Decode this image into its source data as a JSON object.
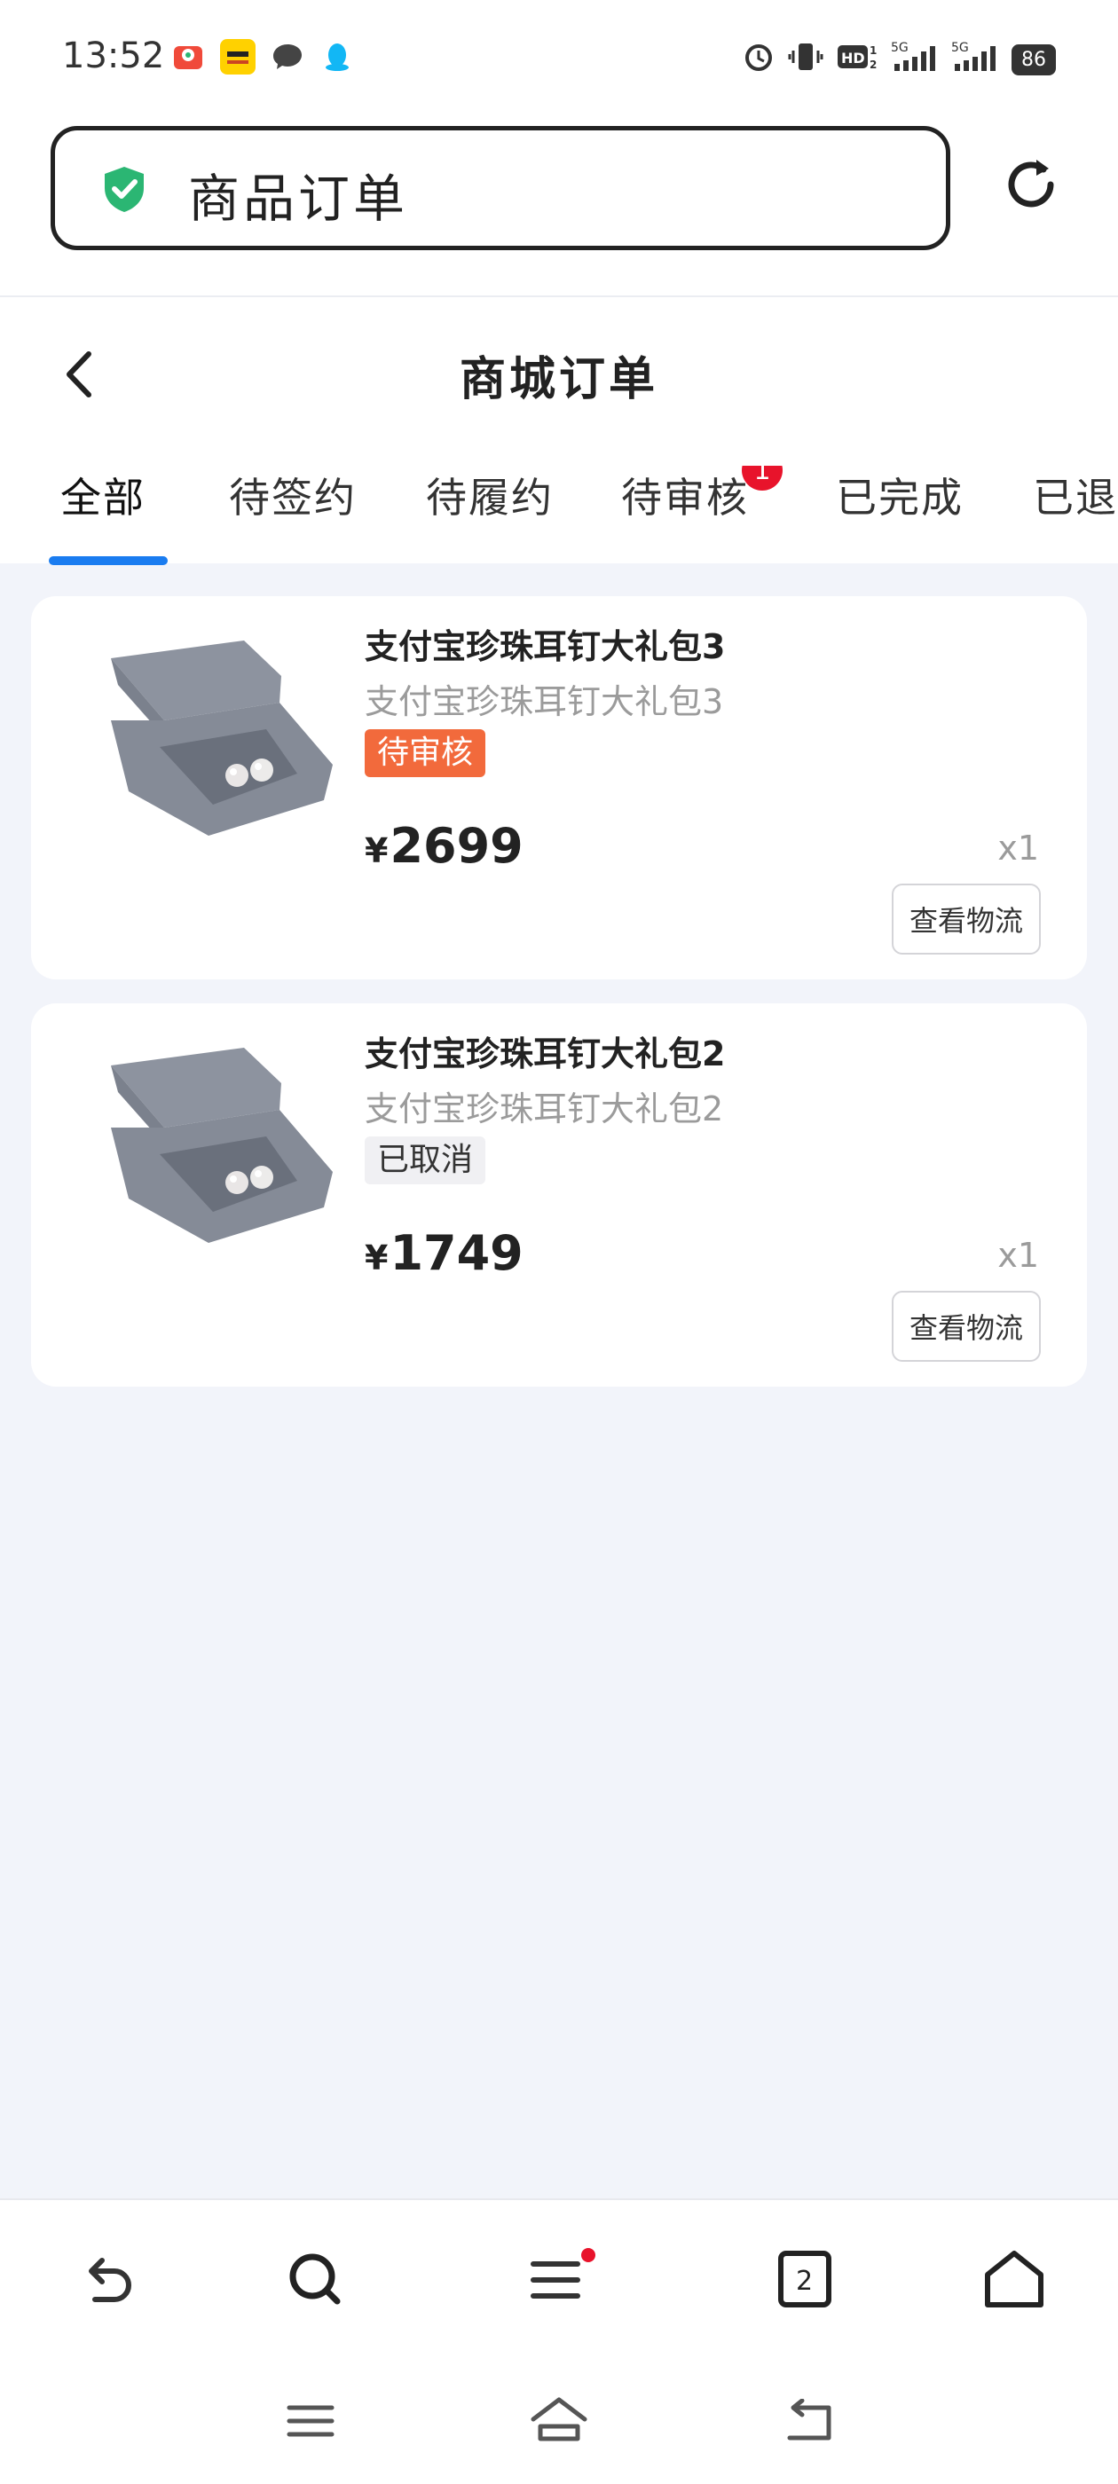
{
  "status_bar": {
    "time": "13:52",
    "battery": "86",
    "app_icons": [
      "meituan-waimai-icon",
      "meituan-icon",
      "chat-bubble-icon",
      "qq-icon"
    ],
    "system_icons": [
      "alarm-icon",
      "vibrate-icon",
      "hd-icon",
      "5g-signal-icon",
      "5g-signal-icon",
      "battery-icon"
    ]
  },
  "browser": {
    "url_text": "商品订单",
    "secure_icon": "shield-check-icon",
    "reload_icon": "reload-icon"
  },
  "page": {
    "title": "商城订单",
    "back_icon": "chevron-left-icon"
  },
  "tabs": [
    {
      "label": "全部",
      "active": true
    },
    {
      "label": "待签约"
    },
    {
      "label": "待履约"
    },
    {
      "label": "待审核",
      "badge": "1"
    },
    {
      "label": "已完成"
    },
    {
      "label": "已退款"
    }
  ],
  "orders": [
    {
      "name": "支付宝珍珠耳钉大礼包3",
      "subtitle": "支付宝珍珠耳钉大礼包3",
      "status": "待审核",
      "price_symbol": "¥",
      "price": "2699",
      "quantity": "x1",
      "action": "查看物流"
    },
    {
      "name": "支付宝珍珠耳钉大礼包2",
      "subtitle": "支付宝珍珠耳钉大礼包2",
      "status": "已取消",
      "price_symbol": "¥",
      "price": "1749",
      "quantity": "x1",
      "action": "查看物流"
    }
  ],
  "toolbar": {
    "items": [
      "back-arrow-icon",
      "search-icon",
      "menu-icon",
      "tabs-icon",
      "home-icon"
    ],
    "tab_count": "2"
  },
  "system_nav": [
    "recent-apps-icon",
    "home-icon",
    "back-icon"
  ],
  "colors": {
    "accent": "#1a7cf0",
    "badge": "#e8132b",
    "pending_tag": "#f26a3c",
    "secure": "#2bb673",
    "background": "#f2f4fa"
  }
}
